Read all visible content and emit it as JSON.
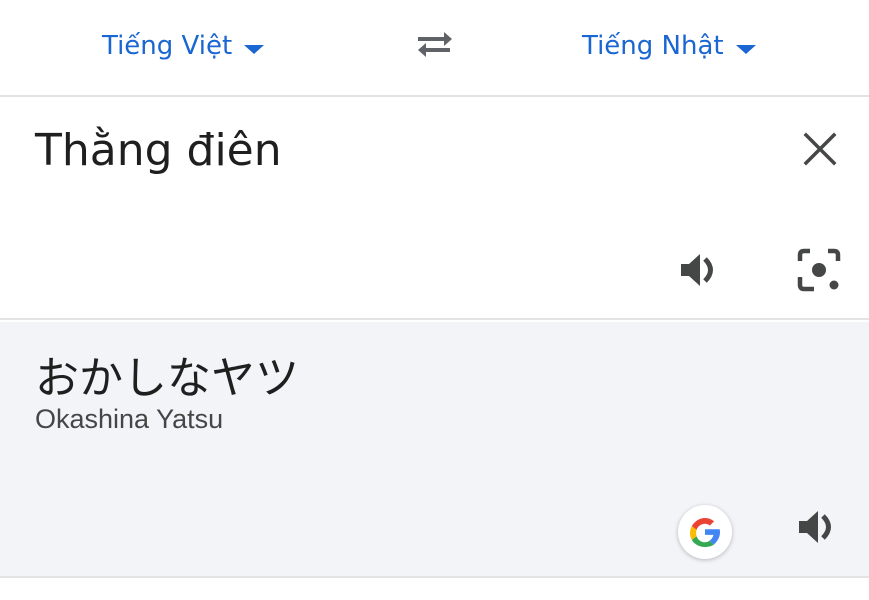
{
  "languages": {
    "source": "Tiếng Việt",
    "target": "Tiếng Nhật"
  },
  "source": {
    "text": "Thằng điên"
  },
  "result": {
    "text": "おかしなヤツ",
    "romanization": "Okashina Yatsu"
  },
  "icons": {
    "swap": "swap-languages-icon",
    "clear": "close-icon",
    "speak": "speaker-icon",
    "camera": "camera-lens-icon",
    "google": "google-logo-icon"
  },
  "colors": {
    "accent": "#1a66d2",
    "result_bg": "#f2f4f8",
    "divider": "#e3e3e3",
    "text": "#1f1f1f"
  }
}
